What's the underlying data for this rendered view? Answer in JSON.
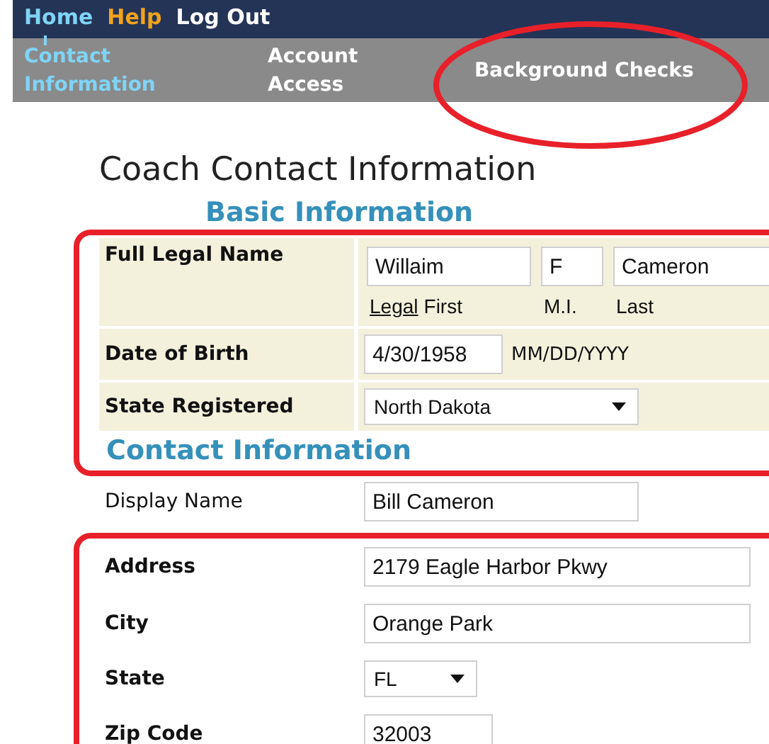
{
  "top_links": [
    {
      "label": "Home",
      "kind": "current"
    },
    {
      "label": "Help",
      "kind": "help"
    },
    {
      "label": "Log Out",
      "kind": "plain"
    }
  ],
  "tabs": [
    {
      "label": "Contact Information",
      "selected": true,
      "marked": false
    },
    {
      "label": "Account Access",
      "selected": false,
      "marked": false
    },
    {
      "label": "Background Checks",
      "selected": false,
      "marked": true
    }
  ],
  "page_title": "Coach Contact Information",
  "form": [
    {
      "kind": "heading",
      "text": "Basic Information",
      "marked": false
    },
    {
      "kind": "name",
      "label": "Full Legal Name",
      "marked": true,
      "fields": [
        {
          "value": "Willaim",
          "caption_link": "Legal",
          "caption": "First"
        },
        {
          "value": "F",
          "caption": "M.I."
        },
        {
          "value": "Cameron",
          "caption": "Last"
        }
      ]
    },
    {
      "kind": "text",
      "label": "Date of Birth",
      "value": "4/30/1958",
      "hint": "MM/DD/YYYY",
      "shaded": true,
      "bold": true,
      "marked": true
    },
    {
      "kind": "select",
      "label": "State Registered",
      "value": "North Dakota",
      "shaded": true,
      "bold": true,
      "marked": true
    },
    {
      "kind": "heading",
      "text": "Contact Information",
      "marked": true
    },
    {
      "kind": "text",
      "label": "Display Name",
      "value": "Bill Cameron",
      "shaded": false,
      "bold": false,
      "marked": false
    },
    {
      "kind": "text",
      "label": "Address",
      "value": "2179 Eagle Harbor Pkwy",
      "shaded": false,
      "bold": true,
      "marked": true
    },
    {
      "kind": "text",
      "label": "City",
      "value": "Orange Park",
      "shaded": false,
      "bold": true,
      "marked": true
    },
    {
      "kind": "select",
      "label": "State",
      "value": "FL",
      "shaded": false,
      "bold": true,
      "marked": true
    },
    {
      "kind": "text",
      "label": "Zip Code",
      "value": "32003",
      "shaded": false,
      "bold": true,
      "marked": true
    }
  ]
}
